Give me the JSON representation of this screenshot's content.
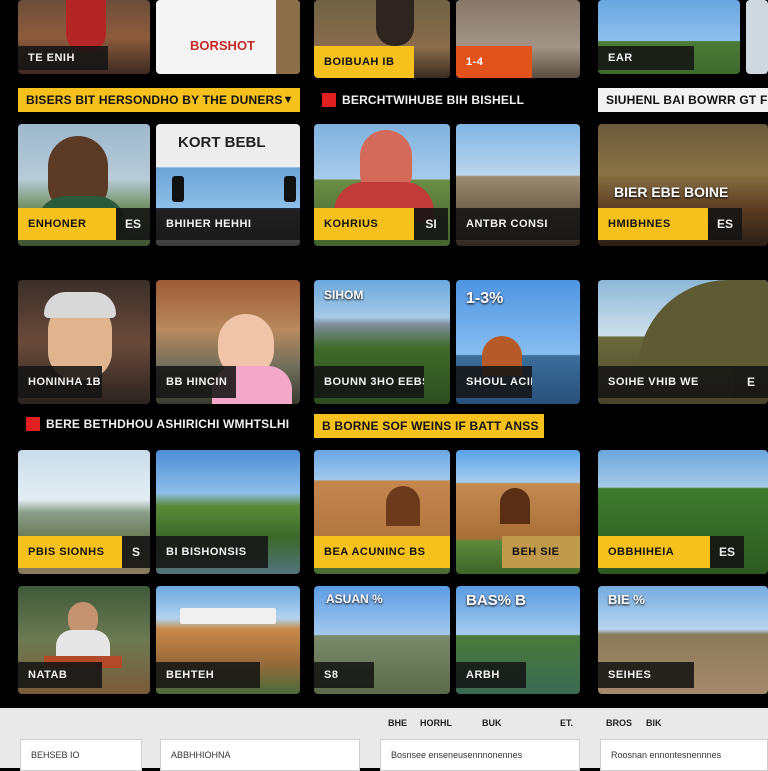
{
  "sections": {
    "s1_left": "BISERS BIT HERSONDHO BY THE DUNERS",
    "s1_mid": "BERCHTWIHUBE BIH BISHELL",
    "s1_right": "SIUHENL BAI BOWRR GT FIR",
    "s2": "BERE BETHDHOU ASHIRICHI WMHTSLHI",
    "s3": "B BORNE SOF WEINS IF BATT ANSS"
  },
  "top_row": {
    "t1_cap": "TE ENIH",
    "t2_overlay": "BORSHOT",
    "t3_cap": "BOIBUAH IB",
    "t4_overlay": "1-4",
    "t5_cap": "EAR"
  },
  "row1": {
    "t1_cap": "ENHONER",
    "t1_badge": "ES",
    "t2_overlay": "KORT BEBL",
    "t2_cap": "BHIHER HEHHI",
    "t3_cap": "KOHRIUS",
    "t3_badge": "SI",
    "t4_cap": "ANTBR CONSI",
    "t5_overlay": "BIER EBE BOINE",
    "t5_cap": "HMIBHNES",
    "t5_badge": "ES"
  },
  "row2": {
    "t1_cap": "HONINHA 1B",
    "t2_cap": "BB HINCIN",
    "t3_overlay": "SIHOM",
    "t3_cap": "BOUNN 3HO EEBS",
    "t4_overlay": "1-3%",
    "t4_cap": "SHOUL ACIN",
    "t5_cap": "SOIHE VHIB  WE",
    "t5_badge": "E"
  },
  "row3": {
    "t1_cap": "PBIS SIONHS",
    "t1_badge": "S",
    "t2_cap": "BI BISHONSIS",
    "t3_cap": "BEA ACUNINC BS",
    "t4_cap": "BEH SIE",
    "t5_cap": "OBBHIHEIA",
    "t5_badge": "ES"
  },
  "row4": {
    "t1_cap": "NATAB",
    "t2_cap": "BEHTEH",
    "t3_overlay": "ASUAN %",
    "t3_cap": "S8",
    "t4_overlay": "BAS% B",
    "t4_cap": "ARBH",
    "t5_overlay": "BIE %",
    "t5_cap": "SEIHES"
  },
  "footer": {
    "links": [
      "BHE",
      "HORHL",
      "BUK",
      "ET.",
      "BROS",
      "BIK"
    ],
    "fields": [
      "BEHSEB IO",
      "ABBHHIOHNA",
      "Bosnsee enseneusennnonennes",
      "Roosnan ennontesnennnes"
    ]
  },
  "colors": {
    "accent": "#f6c11c",
    "background": "#000000",
    "flag": "#e02020",
    "footer": "#e9e9e9"
  },
  "icons": [
    "flag-icon",
    "chevron-down-icon"
  ]
}
